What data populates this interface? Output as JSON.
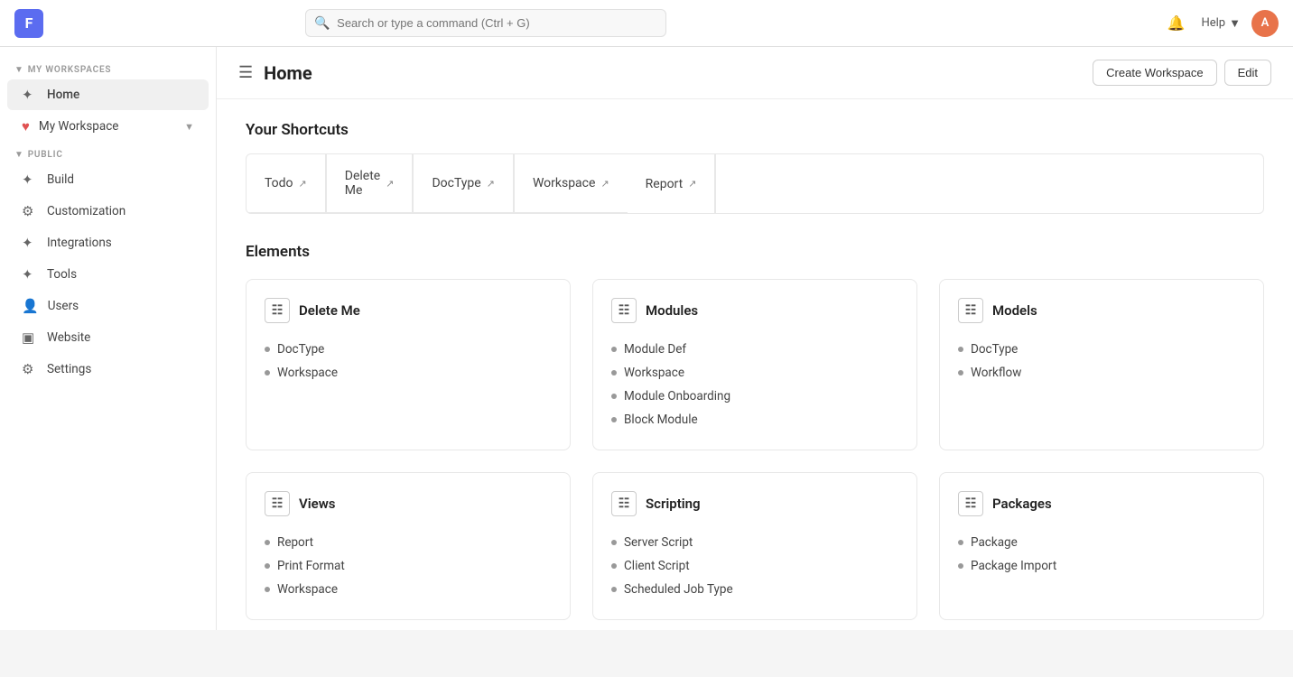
{
  "navbar": {
    "logo_letter": "F",
    "search_placeholder": "Search or type a command (Ctrl + G)",
    "help_label": "Help",
    "avatar_letter": "A"
  },
  "header": {
    "title": "Home",
    "create_workspace_btn": "Create Workspace",
    "edit_btn": "Edit"
  },
  "sidebar": {
    "my_workspaces_label": "MY WORKSPACES",
    "public_label": "PUBLIC",
    "my_workspace_items": [
      {
        "id": "home",
        "label": "Home",
        "active": true
      },
      {
        "id": "my-workspace",
        "label": "My Workspace",
        "has_chevron": true
      }
    ],
    "public_items": [
      {
        "id": "build",
        "label": "Build"
      },
      {
        "id": "customization",
        "label": "Customization"
      },
      {
        "id": "integrations",
        "label": "Integrations"
      },
      {
        "id": "tools",
        "label": "Tools"
      },
      {
        "id": "users",
        "label": "Users"
      },
      {
        "id": "website",
        "label": "Website"
      },
      {
        "id": "settings",
        "label": "Settings"
      }
    ]
  },
  "shortcuts": {
    "title": "Your Shortcuts",
    "items_row1": [
      {
        "label": "Todo"
      },
      {
        "label": "Delete Me"
      },
      {
        "label": "DocType"
      },
      {
        "label": "Workspace"
      }
    ],
    "items_row2": [
      {
        "label": "Report"
      }
    ]
  },
  "elements": {
    "title": "Elements",
    "cards": [
      {
        "id": "delete-me",
        "label": "Delete Me",
        "items": [
          "DocType",
          "Workspace"
        ]
      },
      {
        "id": "modules",
        "label": "Modules",
        "items": [
          "Module Def",
          "Workspace",
          "Module Onboarding",
          "Block Module"
        ]
      },
      {
        "id": "models",
        "label": "Models",
        "items": [
          "DocType",
          "Workflow"
        ]
      }
    ]
  },
  "elements2": {
    "cards": [
      {
        "id": "views",
        "label": "Views",
        "items": [
          "Report",
          "Print Format",
          "Workspace"
        ]
      },
      {
        "id": "scripting",
        "label": "Scripting",
        "items": [
          "Server Script",
          "Client Script",
          "Scheduled Job Type"
        ]
      },
      {
        "id": "packages",
        "label": "Packages",
        "items": [
          "Package",
          "Package Import"
        ]
      }
    ]
  }
}
